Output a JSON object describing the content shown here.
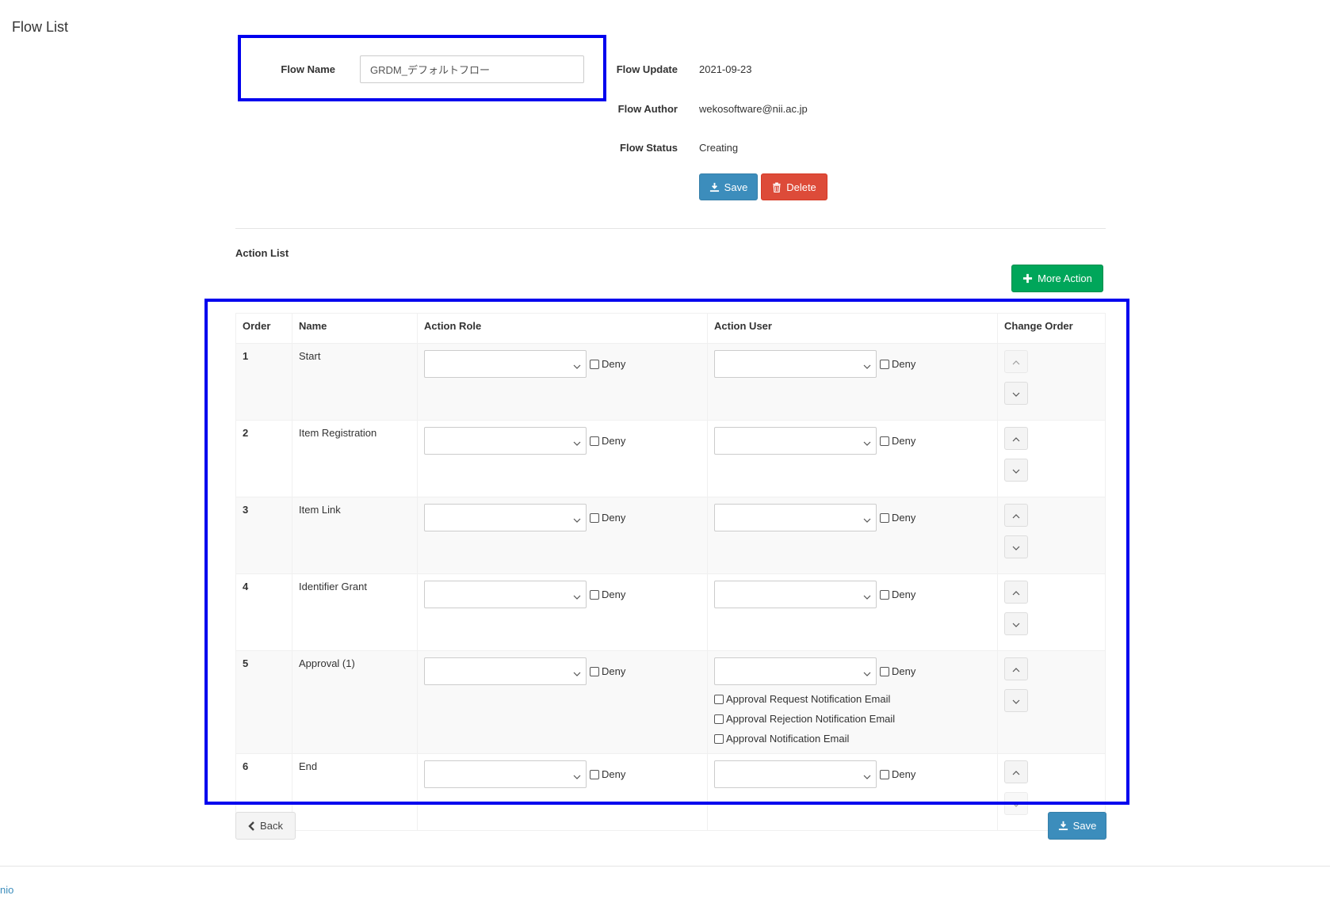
{
  "sidebar": {
    "title": "Flow List"
  },
  "flow": {
    "name_label": "Flow Name",
    "name_value": "GRDM_デフォルトフロー",
    "update_label": "Flow Update",
    "update_value": "2021-09-23",
    "author_label": "Flow Author",
    "author_value": "wekosoftware@nii.ac.jp",
    "status_label": "Flow Status",
    "status_value": "Creating",
    "save_label": "Save",
    "delete_label": "Delete"
  },
  "action_list": {
    "title": "Action List",
    "more_action_label": "More Action",
    "columns": [
      "Order",
      "Name",
      "Action Role",
      "Action User",
      "Change Order"
    ],
    "deny_label": "Deny",
    "rows": [
      {
        "order": "1",
        "name": "Start"
      },
      {
        "order": "2",
        "name": "Item Registration"
      },
      {
        "order": "3",
        "name": "Item Link"
      },
      {
        "order": "4",
        "name": "Identifier Grant"
      },
      {
        "order": "5",
        "name": "Approval (1)",
        "emails": [
          "Approval Request Notification Email",
          "Approval Rejection Notification Email",
          "Approval Notification Email"
        ]
      },
      {
        "order": "6",
        "name": "End"
      }
    ]
  },
  "bottom": {
    "back_label": "Back",
    "save_label": "Save"
  },
  "footer": {
    "link_text": "nio"
  },
  "colors": {
    "primary": "#3c8dbc",
    "danger": "#dd4b39",
    "success": "#00a65a",
    "annotation": "#0000ee"
  }
}
